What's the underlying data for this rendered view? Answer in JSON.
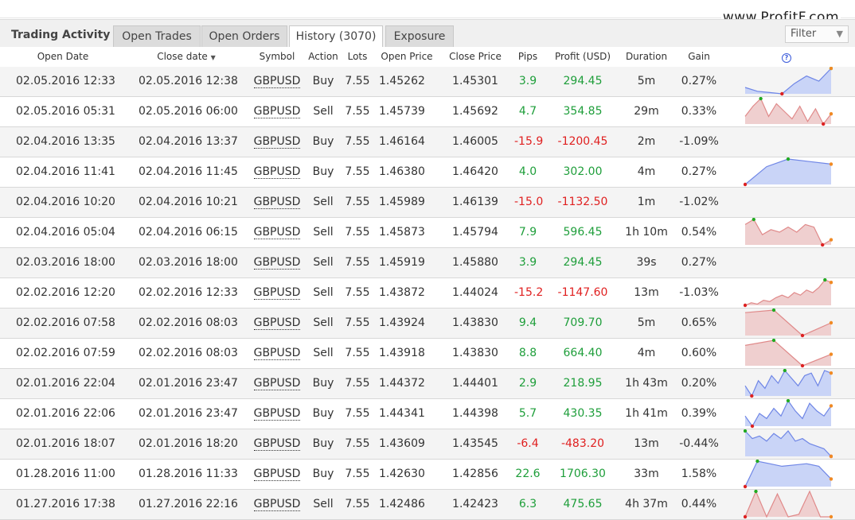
{
  "watermark": "www.ProfitF.com",
  "panel": {
    "title": "Trading Activity",
    "tabs": [
      "Open Trades",
      "Open Orders",
      "History (3070)",
      "Exposure"
    ],
    "active_tab": 2,
    "filter_label": "Filter"
  },
  "columns": {
    "open_date": "Open Date",
    "close_date": "Close date",
    "symbol": "Symbol",
    "action": "Action",
    "lots": "Lots",
    "open_price": "Open Price",
    "close_price": "Close Price",
    "pips": "Pips",
    "profit": "Profit (USD)",
    "duration": "Duration",
    "gain": "Gain",
    "help": "?"
  },
  "trades": [
    {
      "open_date": "02.05.2016 12:33",
      "close_date": "02.05.2016 12:38",
      "symbol": "GBPUSD",
      "action": "Buy",
      "lots": "7.55",
      "open_price": "1.45262",
      "close_price": "1.45301",
      "pips": "3.9",
      "profit": "294.45",
      "duration": "5m",
      "gain": "0.27%",
      "result": "win",
      "spark": [
        0.75,
        0.9,
        0.95,
        1.0,
        0.6,
        0.3,
        0.5,
        0.0
      ]
    },
    {
      "open_date": "02.05.2016 05:31",
      "close_date": "02.05.2016 06:00",
      "symbol": "GBPUSD",
      "action": "Sell",
      "lots": "7.55",
      "open_price": "1.45739",
      "close_price": "1.45692",
      "pips": "4.7",
      "profit": "354.85",
      "duration": "29m",
      "gain": "0.33%",
      "result": "win",
      "spark": [
        0.7,
        0.3,
        0.0,
        0.7,
        0.2,
        0.5,
        0.8,
        0.3,
        0.9,
        0.4,
        1.0,
        0.6
      ]
    },
    {
      "open_date": "02.04.2016 13:35",
      "close_date": "02.04.2016 13:37",
      "symbol": "GBPUSD",
      "action": "Buy",
      "lots": "7.55",
      "open_price": "1.46164",
      "close_price": "1.46005",
      "pips": "-15.9",
      "profit": "-1200.45",
      "duration": "2m",
      "gain": "-1.09%",
      "result": "loss",
      "spark": []
    },
    {
      "open_date": "02.04.2016 11:41",
      "close_date": "02.04.2016 11:45",
      "symbol": "GBPUSD",
      "action": "Buy",
      "lots": "7.55",
      "open_price": "1.46380",
      "close_price": "1.46420",
      "pips": "4.0",
      "profit": "302.00",
      "duration": "4m",
      "gain": "0.27%",
      "result": "win",
      "spark": [
        1.0,
        0.3,
        0.0,
        0.1,
        0.2
      ]
    },
    {
      "open_date": "02.04.2016 10:20",
      "close_date": "02.04.2016 10:21",
      "symbol": "GBPUSD",
      "action": "Sell",
      "lots": "7.55",
      "open_price": "1.45989",
      "close_price": "1.46139",
      "pips": "-15.0",
      "profit": "-1132.50",
      "duration": "1m",
      "gain": "-1.02%",
      "result": "loss",
      "spark": []
    },
    {
      "open_date": "02.04.2016 05:04",
      "close_date": "02.04.2016 06:15",
      "symbol": "GBPUSD",
      "action": "Sell",
      "lots": "7.55",
      "open_price": "1.45873",
      "close_price": "1.45794",
      "pips": "7.9",
      "profit": "596.45",
      "duration": "1h 10m",
      "gain": "0.54%",
      "result": "win",
      "spark": [
        0.2,
        0.0,
        0.6,
        0.4,
        0.5,
        0.3,
        0.5,
        0.2,
        0.3,
        1.0,
        0.8
      ]
    },
    {
      "open_date": "02.03.2016 18:00",
      "close_date": "02.03.2016 18:00",
      "symbol": "GBPUSD",
      "action": "Sell",
      "lots": "7.55",
      "open_price": "1.45919",
      "close_price": "1.45880",
      "pips": "3.9",
      "profit": "294.45",
      "duration": "39s",
      "gain": "0.27%",
      "result": "win",
      "spark": []
    },
    {
      "open_date": "02.02.2016 12:20",
      "close_date": "02.02.2016 12:33",
      "symbol": "GBPUSD",
      "action": "Sell",
      "lots": "7.55",
      "open_price": "1.43872",
      "close_price": "1.44024",
      "pips": "-15.2",
      "profit": "-1147.60",
      "duration": "13m",
      "gain": "-1.03%",
      "result": "loss",
      "spark": [
        1.0,
        0.9,
        0.95,
        0.8,
        0.85,
        0.7,
        0.6,
        0.7,
        0.5,
        0.6,
        0.4,
        0.5,
        0.3,
        0.0,
        0.1
      ]
    },
    {
      "open_date": "02.02.2016 07:58",
      "close_date": "02.02.2016 08:03",
      "symbol": "GBPUSD",
      "action": "Sell",
      "lots": "7.55",
      "open_price": "1.43924",
      "close_price": "1.43830",
      "pips": "9.4",
      "profit": "709.70",
      "duration": "5m",
      "gain": "0.65%",
      "result": "win",
      "spark": [
        0.1,
        0.0,
        1.0,
        0.5
      ]
    },
    {
      "open_date": "02.02.2016 07:59",
      "close_date": "02.02.2016 08:03",
      "symbol": "GBPUSD",
      "action": "Sell",
      "lots": "7.55",
      "open_price": "1.43918",
      "close_price": "1.43830",
      "pips": "8.8",
      "profit": "664.40",
      "duration": "4m",
      "gain": "0.60%",
      "result": "win",
      "spark": [
        0.2,
        0.0,
        1.0,
        0.55
      ]
    },
    {
      "open_date": "02.01.2016 22:04",
      "close_date": "02.01.2016 23:47",
      "symbol": "GBPUSD",
      "action": "Buy",
      "lots": "7.55",
      "open_price": "1.44372",
      "close_price": "1.44401",
      "pips": "2.9",
      "profit": "218.95",
      "duration": "1h 43m",
      "gain": "0.20%",
      "result": "win",
      "spark": [
        0.6,
        1.0,
        0.4,
        0.7,
        0.2,
        0.5,
        0.0,
        0.3,
        0.6,
        0.2,
        0.1,
        0.6,
        0.0,
        0.1
      ]
    },
    {
      "open_date": "02.01.2016 22:06",
      "close_date": "02.01.2016 23:47",
      "symbol": "GBPUSD",
      "action": "Buy",
      "lots": "7.55",
      "open_price": "1.44341",
      "close_price": "1.44398",
      "pips": "5.7",
      "profit": "430.35",
      "duration": "1h 41m",
      "gain": "0.39%",
      "result": "win",
      "spark": [
        0.6,
        1.0,
        0.5,
        0.7,
        0.3,
        0.6,
        0.0,
        0.4,
        0.7,
        0.1,
        0.4,
        0.6,
        0.2
      ]
    },
    {
      "open_date": "02.01.2016 18:07",
      "close_date": "02.01.2016 18:20",
      "symbol": "GBPUSD",
      "action": "Buy",
      "lots": "7.55",
      "open_price": "1.43609",
      "close_price": "1.43545",
      "pips": "-6.4",
      "profit": "-483.20",
      "duration": "13m",
      "gain": "-0.44%",
      "result": "loss",
      "spark": [
        0.0,
        0.3,
        0.2,
        0.4,
        0.1,
        0.3,
        0.0,
        0.4,
        0.3,
        0.5,
        0.6,
        0.7,
        1.0
      ]
    },
    {
      "open_date": "01.28.2016 11:00",
      "close_date": "01.28.2016 11:33",
      "symbol": "GBPUSD",
      "action": "Buy",
      "lots": "7.55",
      "open_price": "1.42630",
      "close_price": "1.42856",
      "pips": "22.6",
      "profit": "1706.30",
      "duration": "33m",
      "gain": "1.58%",
      "result": "win",
      "spark": [
        1.0,
        0.0,
        0.1,
        0.2,
        0.15,
        0.1,
        0.2,
        0.7
      ]
    },
    {
      "open_date": "01.27.2016 17:38",
      "close_date": "01.27.2016 22:16",
      "symbol": "GBPUSD",
      "action": "Sell",
      "lots": "7.55",
      "open_price": "1.42486",
      "close_price": "1.42423",
      "pips": "6.3",
      "profit": "475.65",
      "duration": "4h 37m",
      "gain": "0.44%",
      "result": "win",
      "spark": [
        1.0,
        0.0,
        1.0,
        0.1,
        1.0,
        0.9,
        0.0,
        1.0,
        1.0
      ]
    }
  ],
  "colors": {
    "positive": "#1e9e3a",
    "negative": "#e02020",
    "buy_fill": "#c9d4f7",
    "buy_line": "#6f86e6",
    "sell_fill": "#efcfcf",
    "sell_line": "#e08a8a"
  }
}
